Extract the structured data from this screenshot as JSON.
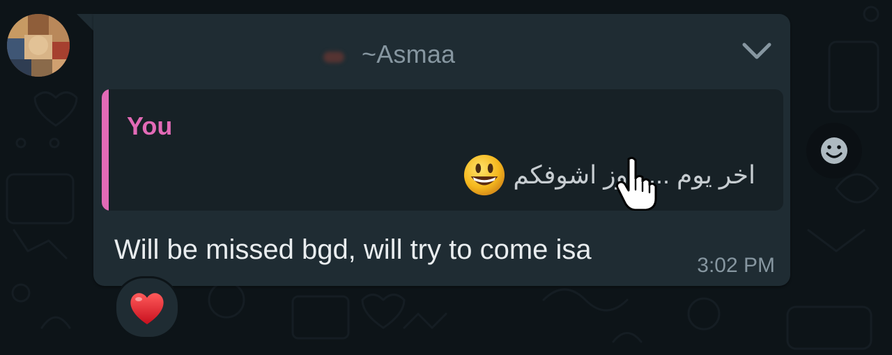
{
  "chat": {
    "sender_name": "~Asmaa",
    "quoted": {
      "author": "You",
      "text": "اخر يوم .... اوز اشوفكم",
      "emoji": "grinning-face-emoji"
    },
    "message": {
      "text": "Will be missed bgd, will try to come isa",
      "time": "3:02 PM"
    },
    "reaction": {
      "emoji": "red-heart-emoji"
    }
  },
  "icons": {
    "menu": "chevron-down-icon",
    "react": "smiley-icon",
    "cursor": "hand-pointer-icon"
  },
  "colors": {
    "background": "#0d1418",
    "bubble": "#1f2c33",
    "quote_background": "#172126",
    "quote_accent": "#e26ab6",
    "primary_text": "#e9edef",
    "secondary_text": "#8696a0"
  }
}
